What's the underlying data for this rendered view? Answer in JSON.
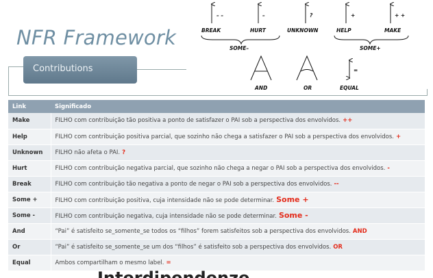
{
  "title": "NFR Framework",
  "section_label": "Contributions",
  "diagram": {
    "labels": {
      "break": "BREAK",
      "hurt": "HURT",
      "unknown": "UNKNOWN",
      "help": "HELP",
      "make": "MAKE",
      "some_minus": "SOME–",
      "some_plus": "SOME+",
      "and": "AND",
      "or": "OR",
      "equal": "EQUAL"
    },
    "marks": {
      "break": "– –",
      "hurt": "–",
      "unknown": "?",
      "help": "+",
      "make": "+ +",
      "equal": "="
    }
  },
  "table": {
    "headers": [
      "Link",
      "Significado"
    ],
    "rows": [
      {
        "link": "Make",
        "text": "FILHO com contribuição tão positiva a ponto de satisfazer o PAI sob a perspectiva dos envolvidos.",
        "symbol": "++"
      },
      {
        "link": "Help",
        "text": "FILHO com contribuição positiva parcial, que sozinho  não chega a satisfazer o PAI sob a perspectiva dos envolvidos.",
        "symbol": "+"
      },
      {
        "link": "Unknown",
        "text": "FILHO não afeta o PAI.",
        "symbol": "?"
      },
      {
        "link": "Hurt",
        "text": "FILHO com contribuição  negativa parcial, que sozinho não chega a negar o PAI sob a perspectiva dos envolvidos.",
        "symbol": "-"
      },
      {
        "link": "Break",
        "text": "FILHO com contribuição tão negativa a ponto de negar o PAI sob a perspectiva dos envolvidos.",
        "symbol": "--"
      },
      {
        "link": "Some +",
        "text": "FILHO com contribuição positiva, cuja intensidade não se pode determinar.",
        "symbol": "Some +"
      },
      {
        "link": "Some -",
        "text": "FILHO com contribuição negativa, cuja intensidade não se pode determinar.",
        "symbol": "Some -"
      },
      {
        "link": "And",
        "text": "“Pai” é satisfeito se_somente_se todos os “filhos” forem  satisfeitos sob a perspectiva dos envolvidos.",
        "symbol": "AND"
      },
      {
        "link": "Or",
        "text": "“Pai” é satisfeito se_somente_se um dos “filhos” é satisfeito sob a perspectiva dos envolvidos.",
        "symbol": "OR"
      },
      {
        "link": "Equal",
        "text": "Ambos compartilham o mesmo label.",
        "symbol": "="
      }
    ]
  },
  "bottom_text": "Interdipendenze"
}
